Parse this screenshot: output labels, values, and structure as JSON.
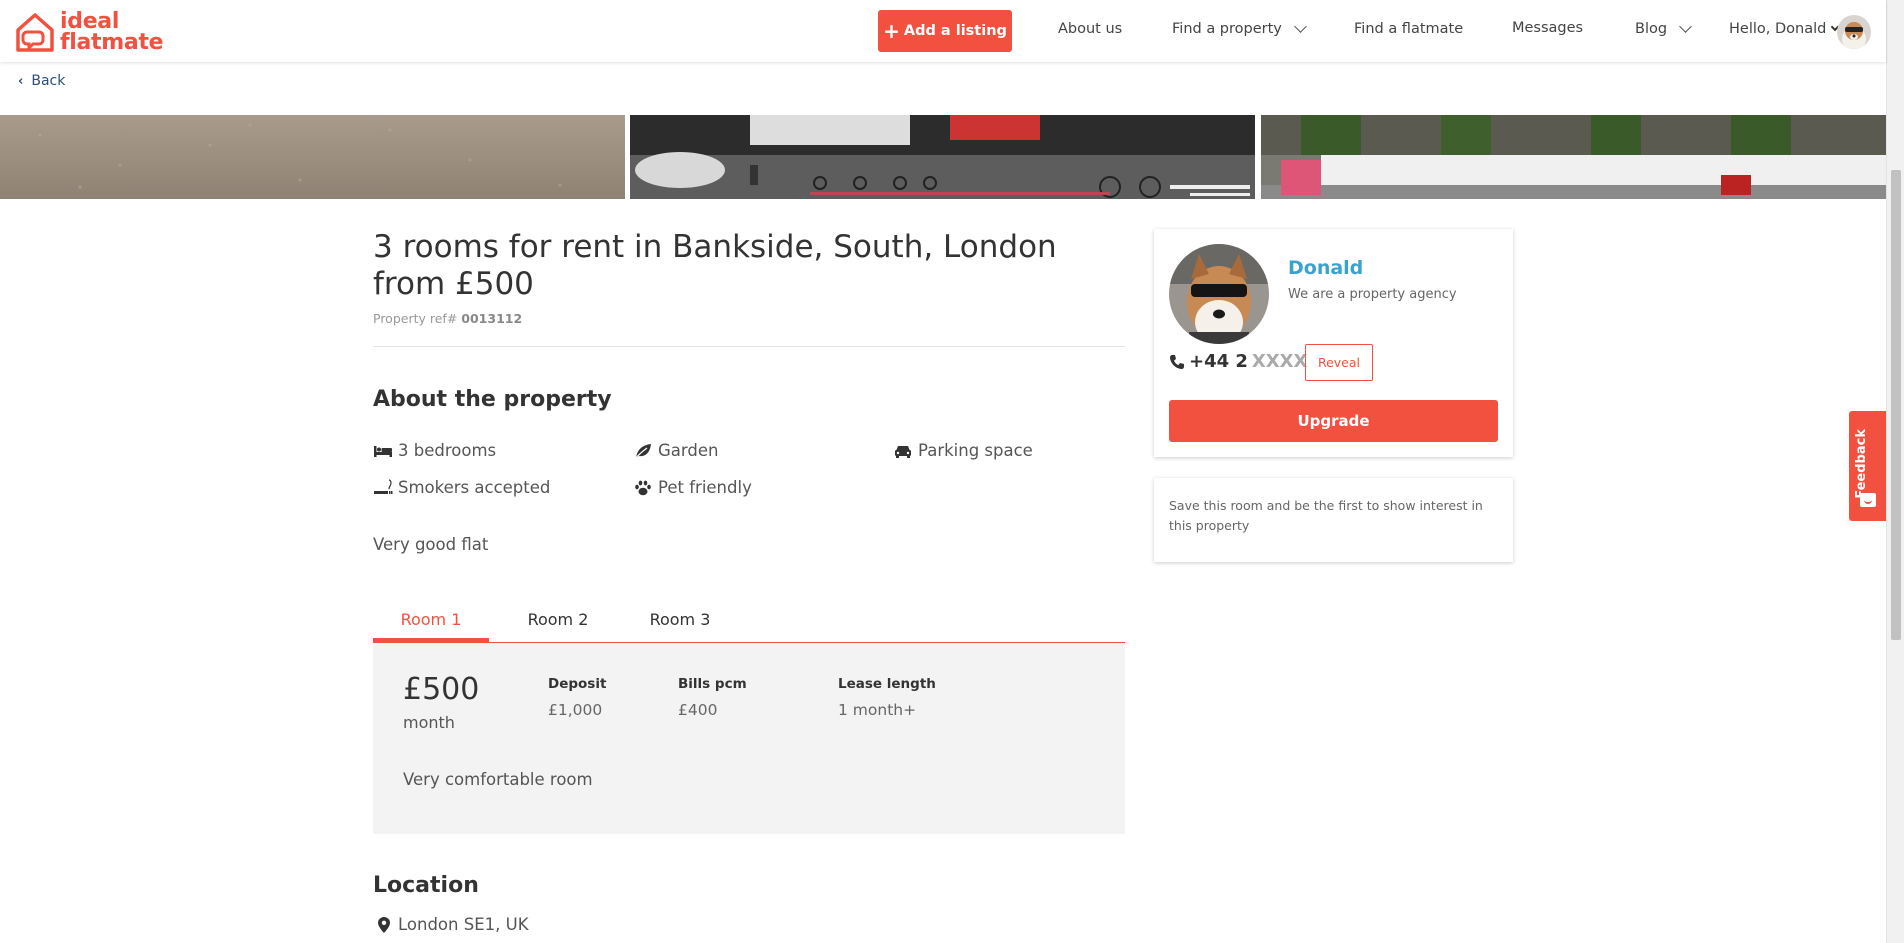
{
  "brand": {
    "line1": "ideal",
    "line2": "flatmate",
    "accent_color": "#f2513f",
    "link_color": "#3aa2d0"
  },
  "nav": {
    "add_listing": "Add a listing",
    "about_us": "About us",
    "find_property": "Find a property",
    "find_flatmate": "Find a flatmate",
    "messages": "Messages",
    "blog": "Blog",
    "user_greeting": "Hello, Donald"
  },
  "back": "Back",
  "listing": {
    "title": "3 rooms for rent in Bankside, South, London from £500",
    "ref_label": "Property ref#",
    "ref_value": "0013112"
  },
  "about": {
    "heading": "About the property",
    "features": [
      {
        "icon": "bed-icon",
        "label": "3 bedrooms"
      },
      {
        "icon": "leaf-icon",
        "label": "Garden"
      },
      {
        "icon": "car-icon",
        "label": "Parking space"
      },
      {
        "icon": "smoking-icon",
        "label": "Smokers accepted"
      },
      {
        "icon": "paw-icon",
        "label": "Pet friendly"
      }
    ],
    "description": "Very good flat"
  },
  "rooms": {
    "tabs": [
      "Room 1",
      "Room 2",
      "Room 3"
    ],
    "active_tab": 0,
    "price": "£500",
    "period": "month",
    "deposit_label": "Deposit",
    "deposit_value": "£1,000",
    "bills_label": "Bills pcm",
    "bills_value": "£400",
    "lease_label": "Lease length",
    "lease_value": "1 month+",
    "description": "Very comfortable room"
  },
  "location": {
    "heading": "Location",
    "address": "London SE1, UK"
  },
  "advertiser": {
    "name": "Donald",
    "subtitle": "We are a property agency",
    "phone_prefix": "+44 2",
    "phone_mask": "XXXX",
    "reveal": "Reveal",
    "upgrade": "Upgrade"
  },
  "save_card": {
    "text": "Save this room and be the first to show interest in this property"
  },
  "feedback": "Feedback"
}
